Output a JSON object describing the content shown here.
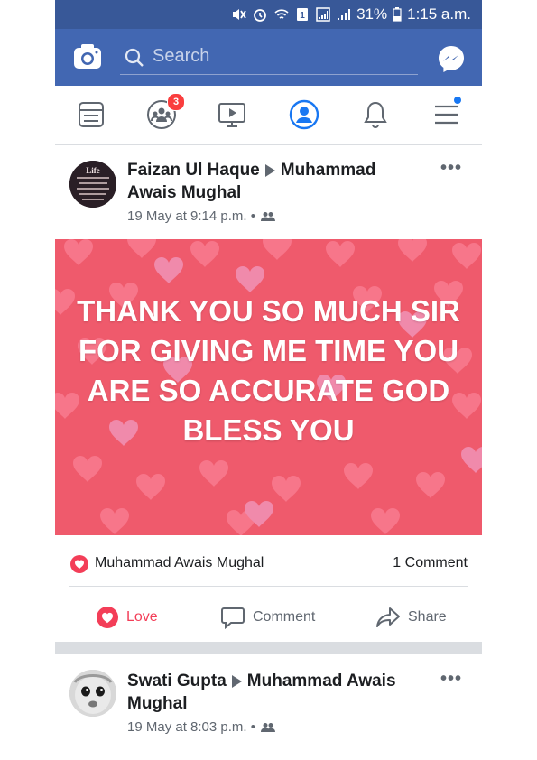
{
  "status_bar": {
    "battery": "31%",
    "time": "1:15 a.m."
  },
  "top_bar": {
    "search_placeholder": "Search"
  },
  "nav": {
    "groups_badge": "3"
  },
  "posts": [
    {
      "author": "Faizan Ul Haque",
      "target": "Muhammad Awais Mughal",
      "timestamp": "19 May at 9:14 p.m. •",
      "text": "THANK YOU SO MUCH SIR FOR GIVING ME TIME YOU ARE SO ACCURATE GOD BLESS YOU",
      "reaction_names": "Muhammad Awais Mughal",
      "comments": "1 Comment",
      "actions": {
        "love": "Love",
        "comment": "Comment",
        "share": "Share"
      }
    },
    {
      "author": "Swati Gupta",
      "target": "Muhammad Awais Mughal",
      "timestamp": "19 May at 8:03 p.m. •"
    }
  ],
  "colors": {
    "header": "#4267b2",
    "status_bar": "#385898",
    "love": "#f33e58",
    "post_background": "#ef5a6c"
  }
}
